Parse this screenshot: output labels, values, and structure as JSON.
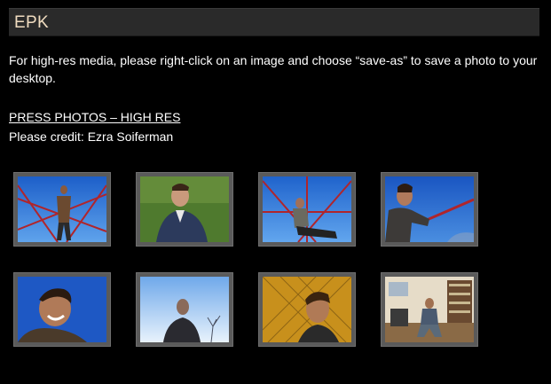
{
  "header": {
    "title": "EPK"
  },
  "intro": {
    "text": "For high-res media, please right-click on an image and choose “save-as” to save a photo to your desktop."
  },
  "press": {
    "link_label": "PRESS PHOTOS – HIGH RES",
    "credit": "Please credit: Ezra Soiferman"
  },
  "photos": [
    {
      "name": "photo-1",
      "scene": "sky-climbing-frame"
    },
    {
      "name": "photo-2",
      "scene": "grass-portrait"
    },
    {
      "name": "photo-3",
      "scene": "sky-climbing-frame-seated"
    },
    {
      "name": "photo-4",
      "scene": "sky-bar-profile"
    },
    {
      "name": "photo-5",
      "scene": "sky-smiling-portrait"
    },
    {
      "name": "photo-6",
      "scene": "sky-looking-up"
    },
    {
      "name": "photo-7",
      "scene": "gold-fence-portrait"
    },
    {
      "name": "photo-8",
      "scene": "studio-room"
    }
  ]
}
